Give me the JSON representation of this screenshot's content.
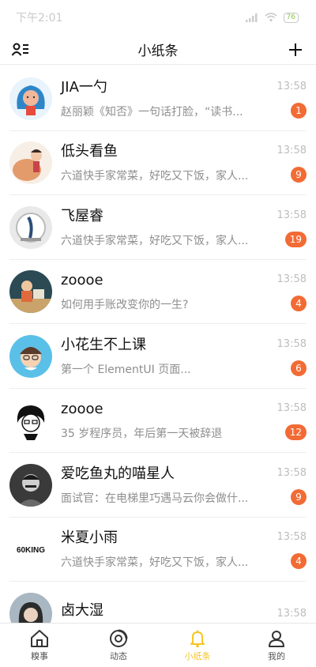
{
  "status": {
    "time": "下午2:01",
    "battery": "76"
  },
  "header": {
    "title": "小纸条"
  },
  "colors": {
    "accent": "#f7c623",
    "badge": "#f26b35"
  },
  "conversations": [
    {
      "name": "JIA一勺",
      "preview": "赵丽颖《知否》一句话打脸，“读书...",
      "time": "13:58",
      "unread": "1"
    },
    {
      "name": "低头看鱼",
      "preview": "六道快手家常菜，好吃又下饭，家人...",
      "time": "13:58",
      "unread": "9"
    },
    {
      "name": "飞屋睿",
      "preview": "六道快手家常菜，好吃又下饭，家人...",
      "time": "13:58",
      "unread": "19"
    },
    {
      "name": "zoooe",
      "preview": "如何用手账改变你的一生?",
      "time": "13:58",
      "unread": "4"
    },
    {
      "name": "小花生不上课",
      "preview": "第一个 ElementUI 页面...",
      "time": "13:58",
      "unread": "6"
    },
    {
      "name": "zoooe",
      "preview": "35 岁程序员，年后第一天被辞退",
      "time": "13:58",
      "unread": "12"
    },
    {
      "name": "爱吃鱼丸的喵星人",
      "preview": "面试官：在电梯里巧遇马云你会做什...",
      "time": "13:58",
      "unread": "9"
    },
    {
      "name": "米夏小雨",
      "preview": "六道快手家常菜，好吃又下饭，家人...",
      "time": "13:58",
      "unread": "4",
      "avatar_text": "60KING"
    },
    {
      "name": "卤大湿",
      "preview": "",
      "time": "13:58",
      "unread": ""
    }
  ],
  "tabs": [
    {
      "label": "糗事",
      "icon": "home-icon"
    },
    {
      "label": "动态",
      "icon": "compass-icon"
    },
    {
      "label": "小纸条",
      "icon": "bell-icon",
      "active": true
    },
    {
      "label": "我的",
      "icon": "user-icon"
    }
  ]
}
